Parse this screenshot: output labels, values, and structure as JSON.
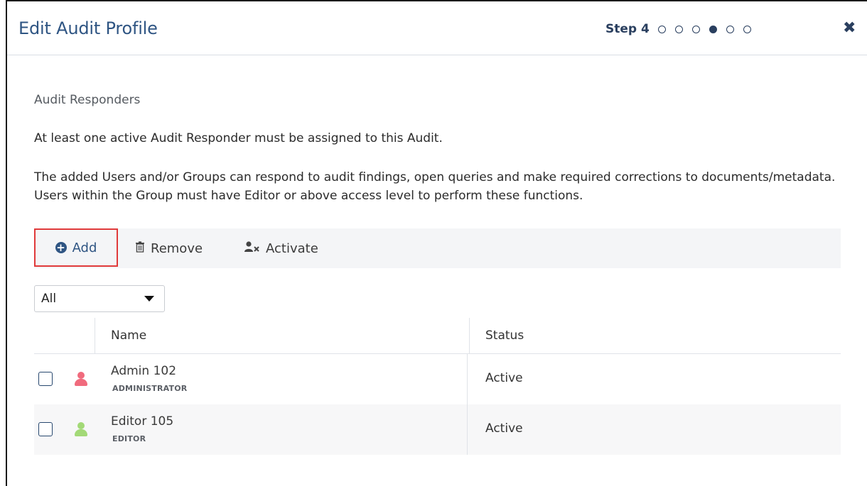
{
  "header": {
    "title": "Edit Audit Profile",
    "step_label": "Step 4",
    "steps": [
      false,
      false,
      false,
      true,
      false,
      false
    ],
    "close_glyph": "✖"
  },
  "section": {
    "title": "Audit Responders",
    "para1": "At least one active Audit Responder must be assigned to this Audit.",
    "para2": "The added Users and/or Groups can respond to audit findings, open queries and make required corrections to documents/metadata. Users within the Group must have Editor or above access level to perform these functions."
  },
  "toolbar": {
    "add_label": "Add",
    "remove_label": "Remove",
    "activate_label": "Activate",
    "highlight_color": "#e03a3a"
  },
  "filter": {
    "selected": "All"
  },
  "table": {
    "columns": {
      "name": "Name",
      "status": "Status"
    },
    "rows": [
      {
        "name": "Admin 102",
        "role": "ADMINISTRATOR",
        "status": "Active",
        "icon": "user-icon",
        "icon_color": "#f06b7d"
      },
      {
        "name": "Editor 105",
        "role": "EDITOR",
        "status": "Active",
        "icon": "user-icon",
        "icon_color": "#a3d977"
      }
    ]
  }
}
